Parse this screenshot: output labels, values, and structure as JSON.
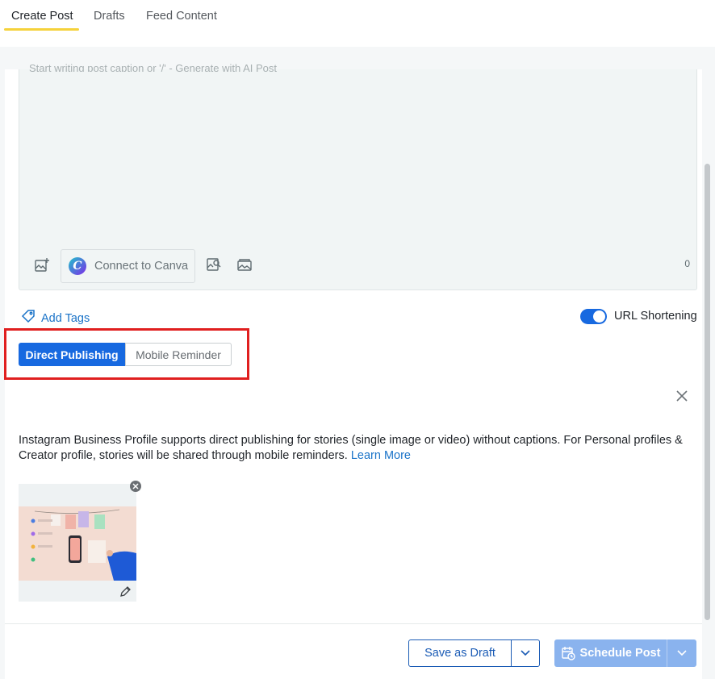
{
  "tabs": [
    {
      "label": "Create Post",
      "active": true
    },
    {
      "label": "Drafts",
      "active": false
    },
    {
      "label": "Feed Content",
      "active": false
    }
  ],
  "editor": {
    "placeholder": "Start writing post caption or '/' - Generate with AI Post",
    "canva_label": "Connect to Canva",
    "char_count": "0"
  },
  "tags": {
    "label": "Add Tags"
  },
  "url_shortening": {
    "label": "URL Shortening",
    "enabled": true
  },
  "publish_mode": {
    "options": [
      "Direct Publishing",
      "Mobile Reminder"
    ],
    "selected": "Direct Publishing"
  },
  "info": {
    "text": "Instagram Business Profile supports direct publishing for stories (single image or video) without captions. For Personal profiles & Creator profile, stories will be shared through mobile reminders.",
    "link_label": "Learn More"
  },
  "footer": {
    "save_draft_label": "Save as Draft",
    "schedule_label": "Schedule Post"
  },
  "colors": {
    "accent": "#1769e0",
    "tab_underline": "#f5d23b",
    "highlight": "#e01f1f"
  }
}
